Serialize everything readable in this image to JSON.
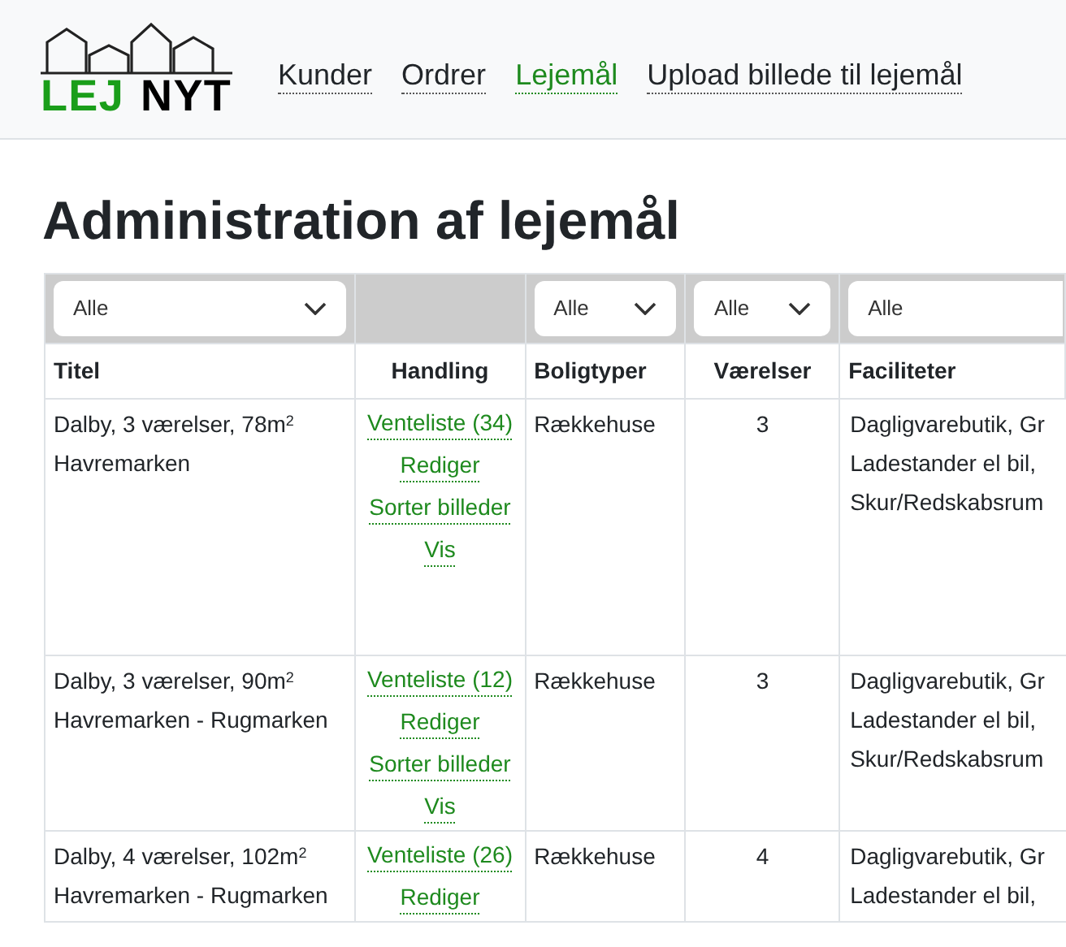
{
  "logo": {
    "part_1": "LEJ",
    "part_2": "NYT"
  },
  "nav": [
    {
      "label": "Kunder",
      "selected": false
    },
    {
      "label": "Ordrer",
      "selected": false
    },
    {
      "label": "Lejemål",
      "selected": true
    },
    {
      "label": "Upload billede til lejemål",
      "selected": false
    }
  ],
  "heading": "Administration af lejemål",
  "table": {
    "filters": [
      {
        "kind": "select",
        "value": "Alle"
      },
      {
        "kind": "none"
      },
      {
        "kind": "select",
        "value": "Alle"
      },
      {
        "kind": "select",
        "value": "Alle"
      },
      {
        "kind": "input",
        "value": "Alle"
      }
    ],
    "columns": [
      "Titel",
      "Handling",
      "Boligtyper",
      "Værelser",
      "Faciliteter"
    ],
    "rows": [
      {
        "title": "Dalby, 3 værelser, 78m$^{2}$",
        "location": "Havremarken",
        "actions": [
          "Venteliste (34)",
          "Rediger",
          "Sorter billeder",
          "Vis"
        ],
        "type": "Rækkehuse",
        "rooms": "3",
        "facilities": [
          "Dagligvarebutik, Gr",
          "Ladestander el bil,",
          "Skur/Redskabsrum"
        ]
      },
      {
        "title": "Dalby, 3 værelser, 90m$^{2}$",
        "location": "Havremarken - Rugmarken",
        "actions": [
          "Venteliste (12)",
          "Rediger",
          "Sorter billeder",
          "Vis"
        ],
        "type": "Rækkehuse",
        "rooms": "3",
        "facilities": [
          "Dagligvarebutik, Gr",
          "Ladestander el bil,",
          "Skur/Redskabsrum"
        ]
      },
      {
        "title": "Dalby, 4 værelser, 102m$^{2}$",
        "location": "Havremarken - Rugmarken",
        "actions": [
          "Venteliste (26)",
          "Rediger"
        ],
        "type": "Rækkehuse",
        "rooms": "4",
        "facilities": [
          "Dagligvarebutik, Gr",
          "Ladestander el bil,"
        ]
      }
    ]
  }
}
